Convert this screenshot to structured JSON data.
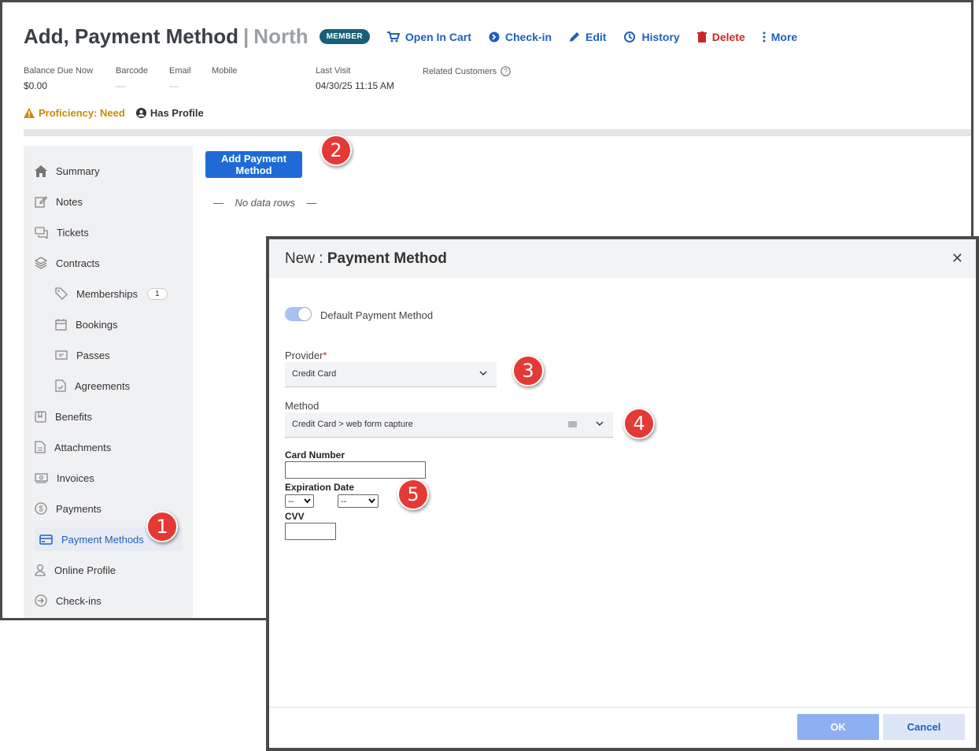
{
  "header": {
    "title": "Add, Payment Method",
    "separator": "|",
    "subtitle": "North",
    "badge": "MEMBER",
    "actions": [
      {
        "label": "Open In Cart",
        "icon": "cart-icon"
      },
      {
        "label": "Check-in",
        "icon": "arrow-circle-icon"
      },
      {
        "label": "Edit",
        "icon": "pencil-icon"
      },
      {
        "label": "History",
        "icon": "history-icon"
      },
      {
        "label": "Delete",
        "icon": "trash-icon"
      },
      {
        "label": "More",
        "icon": "dots-vertical-icon"
      }
    ]
  },
  "info": {
    "balance_label": "Balance Due Now",
    "balance_value": "$0.00",
    "barcode_label": "Barcode",
    "barcode_value": "—",
    "email_label": "Email",
    "email_value": "—",
    "mobile_label": "Mobile",
    "last_visit_label": "Last Visit",
    "last_visit_value": "04/30/25 11:15 AM",
    "related_label": "Related Customers"
  },
  "proficiency": {
    "label": "Proficiency: Need",
    "profile_label": "Has Profile"
  },
  "sidebar": {
    "items": [
      {
        "label": "Summary",
        "icon": "home-icon"
      },
      {
        "label": "Notes",
        "icon": "edit-note-icon"
      },
      {
        "label": "Tickets",
        "icon": "chat-icon"
      },
      {
        "label": "Contracts",
        "icon": "layers-icon"
      },
      {
        "label": "Memberships",
        "icon": "tag-icon",
        "count": "1"
      },
      {
        "label": "Bookings",
        "icon": "calendar-icon"
      },
      {
        "label": "Passes",
        "icon": "ticket-icon"
      },
      {
        "label": "Agreements",
        "icon": "document-check-icon"
      },
      {
        "label": "Benefits",
        "icon": "bookmark-icon"
      },
      {
        "label": "Attachments",
        "icon": "file-icon"
      },
      {
        "label": "Invoices",
        "icon": "money-icon"
      },
      {
        "label": "Payments",
        "icon": "dollar-circle-icon"
      },
      {
        "label": "Payment Methods",
        "icon": "credit-card-icon"
      },
      {
        "label": "Online Profile",
        "icon": "user-icon"
      },
      {
        "label": "Check-ins",
        "icon": "arrow-circle-icon"
      }
    ]
  },
  "main": {
    "add_button": "Add Payment Method",
    "empty_text": "—    No data rows    —"
  },
  "modal": {
    "title_prefix": "New : ",
    "title_main": "Payment Method",
    "close": "✕",
    "toggle_label": "Default Payment Method",
    "provider_label": "Provider",
    "required_mark": "*",
    "provider_value": "Credit Card",
    "method_label": "Method",
    "method_value": "Credit Card > web form capture",
    "card_number_label": "Card Number",
    "expiration_label": "Expiration Date",
    "exp_month": "--",
    "exp_year": "--",
    "cvv_label": "CVV",
    "ok": "OK",
    "cancel": "Cancel"
  },
  "callouts": [
    "1",
    "2",
    "3",
    "4",
    "5"
  ],
  "colors": {
    "primary": "#1e6bd6",
    "danger": "#c62828",
    "warn": "#c98a00",
    "badge": "#17607a",
    "callout": "#e53935"
  }
}
